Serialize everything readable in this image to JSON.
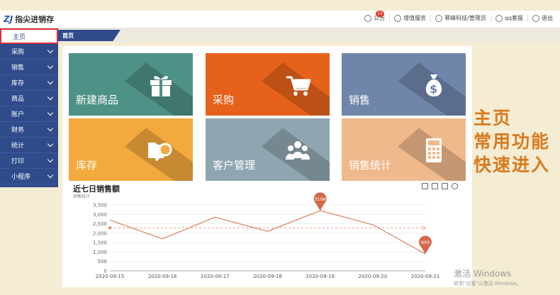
{
  "app": {
    "logo_mark": "ZJ",
    "logo_text": "指尖进销存"
  },
  "topbar": {
    "notice_label": "公告",
    "notice_badge": "13",
    "service_label": "增值服务",
    "user_label": "寒峰科技/管理员",
    "support_label": "qq客服",
    "logout_label": "退出"
  },
  "sidebar": {
    "items": [
      {
        "label": "主页",
        "icon": "grid-icon"
      },
      {
        "label": "采购",
        "icon": "bag-icon"
      },
      {
        "label": "销售",
        "icon": "money-icon"
      },
      {
        "label": "库存",
        "icon": "home-icon"
      },
      {
        "label": "商品",
        "icon": "gift-icon"
      },
      {
        "label": "账户",
        "icon": "user-icon"
      },
      {
        "label": "财务",
        "icon": "compass-icon"
      },
      {
        "label": "统计",
        "icon": "chart-icon"
      },
      {
        "label": "打印",
        "icon": "printer-icon"
      },
      {
        "label": "小程序",
        "icon": ""
      }
    ]
  },
  "tabs": {
    "home": "首页"
  },
  "tiles": [
    {
      "label": "新建商品",
      "icon": "gift-icon",
      "color": "#4e9186"
    },
    {
      "label": "采购",
      "icon": "cart-icon",
      "color": "#e6621a"
    },
    {
      "label": "销售",
      "icon": "moneybag-icon",
      "color": "#6f86aa"
    },
    {
      "label": "库存",
      "icon": "folder-search-icon",
      "color": "#f3a93d"
    },
    {
      "label": "客户管理",
      "icon": "users-icon",
      "color": "#8fa6b0"
    },
    {
      "label": "销售统计",
      "icon": "calculator-icon",
      "color": "#f0b98b"
    }
  ],
  "overlay": {
    "line1": "主页",
    "line2": "常用功能",
    "line3": "快速进入"
  },
  "watermark": {
    "line1": "激活 Windows",
    "line2": "转到\"设置\"以激活 Windows。"
  },
  "chart_data": {
    "type": "line",
    "title": "近七日销售额",
    "subtitle": "销售统计",
    "categories": [
      "2020-09-15",
      "2020-09-16",
      "2020-09-17",
      "2020-09-18",
      "2020-09-19",
      "2020-09-20",
      "2020-09-21"
    ],
    "series": [
      {
        "values": [
          2700,
          1700,
          2850,
          2100,
          3198,
          2450,
          900
        ]
      }
    ],
    "markers": [
      {
        "label": "3198",
        "index": 4
      },
      {
        "label": "900",
        "index": 6
      }
    ],
    "average": 2285,
    "yticks": [
      0,
      500,
      1000,
      1500,
      2000,
      2500,
      3000,
      3500
    ],
    "ylim": [
      0,
      3500
    ],
    "grid": true,
    "colors": {
      "line": "#d9825f",
      "marker": "#d4694a"
    }
  }
}
